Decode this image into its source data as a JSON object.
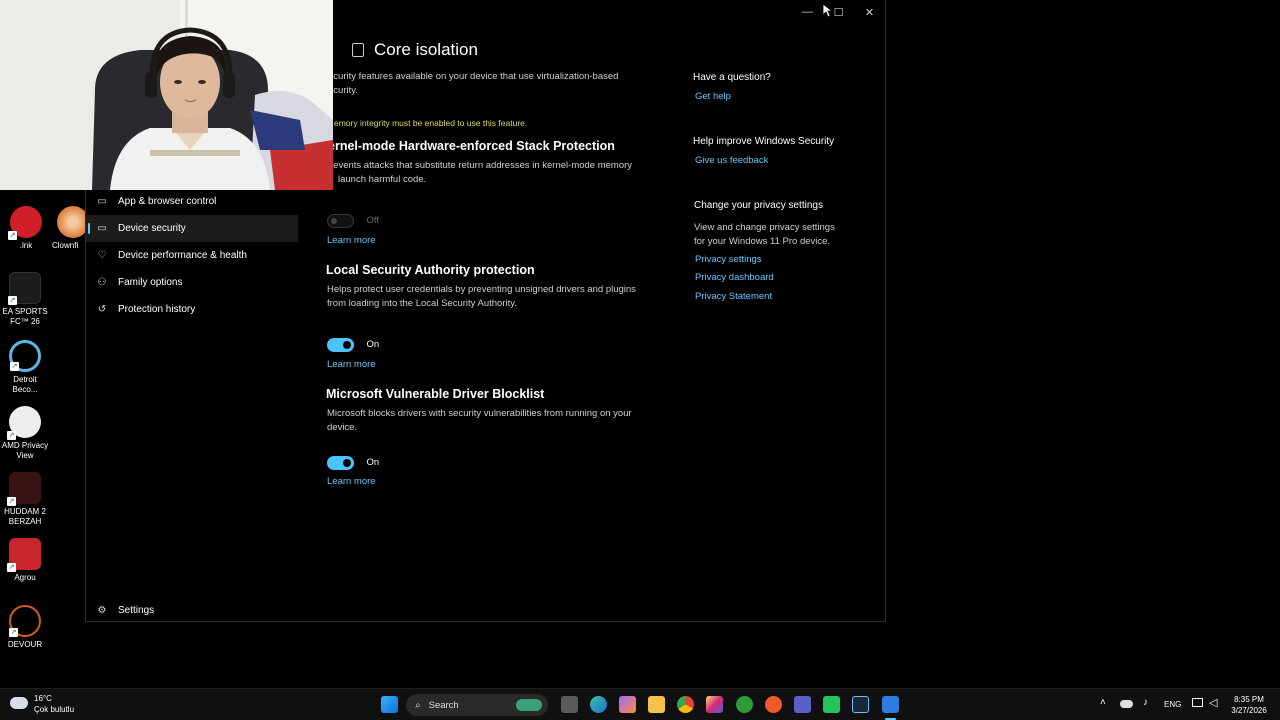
{
  "window": {
    "title": "Core isolation",
    "controls": {
      "minimize": "—",
      "maximize": "☐",
      "close": "✕"
    }
  },
  "nav": {
    "items": [
      {
        "label": "App & browser control",
        "icon": "app-browser-icon"
      },
      {
        "label": "Device security",
        "icon": "laptop-icon",
        "active": true
      },
      {
        "label": "Device performance & health",
        "icon": "heart-icon"
      },
      {
        "label": "Family options",
        "icon": "family-icon"
      },
      {
        "label": "Protection history",
        "icon": "history-icon"
      }
    ],
    "settings": "Settings"
  },
  "main": {
    "intro": "ecurity features available on your device that use virtualization-based ecurity.",
    "intro_line1": "ecurity features available on your device that use virtualization-based",
    "intro_line2": "ecurity.",
    "warning": "emory integrity must be enabled to use this feature.",
    "sections": [
      {
        "title": "ernel-mode Hardware-enforced Stack Protection",
        "desc_line1": "revents attacks that substitute return addresses in kernel-mode memory",
        "desc_line2": "launch harmful code.",
        "toggle_state": "Off",
        "enabled": false,
        "link": "Learn more"
      },
      {
        "title": "Local Security Authority protection",
        "desc_line1": "Helps protect user credentials by preventing unsigned drivers and plugins",
        "desc_line2": "from loading into the Local Security Authority.",
        "toggle_state": "On",
        "enabled": true,
        "link": "Learn more"
      },
      {
        "title": "Microsoft Vulnerable Driver Blocklist",
        "desc_line1": "Microsoft blocks drivers with security vulnerabilities from running on your",
        "desc_line2": "device.",
        "toggle_state": "On",
        "enabled": true,
        "link": "Learn more"
      }
    ]
  },
  "sidebar": {
    "question_heading": "Have a question?",
    "get_help": "Get help",
    "improve_heading": "Help improve Windows Security",
    "feedback": "Give us feedback",
    "privacy_heading": "Change your privacy settings",
    "privacy_text_line1": "View and change privacy settings",
    "privacy_text_line2": "for your Windows 11 Pro device.",
    "privacy_links": [
      "Privacy settings",
      "Privacy dashboard",
      "Privacy Statement"
    ]
  },
  "desktop": {
    "icons": [
      {
        "label": ".lnk",
        "color": "#d11f2a"
      },
      {
        "label": "Clownfi",
        "color": "#e08a4c"
      },
      {
        "label": "EA SPORTS FC™ 26",
        "color": "#1c1c1c"
      },
      {
        "label": "Detroit Beco...",
        "color": "#5bb6e6"
      },
      {
        "label": "AMD Privacy View",
        "color": "#eeeeee"
      },
      {
        "label": "HUDDAM 2 BERZAH",
        "color": "#3a1414"
      },
      {
        "label": "Agrou",
        "color": "#c8252e"
      },
      {
        "label": "DEVOUR",
        "color": "#d05a1c"
      }
    ]
  },
  "taskbar": {
    "weather_temp": "16°C",
    "weather_desc": "Çok bulutlu",
    "search_placeholder": "Search",
    "language": "ENG",
    "time": "8:35 PM",
    "date": "3/27/2026"
  }
}
